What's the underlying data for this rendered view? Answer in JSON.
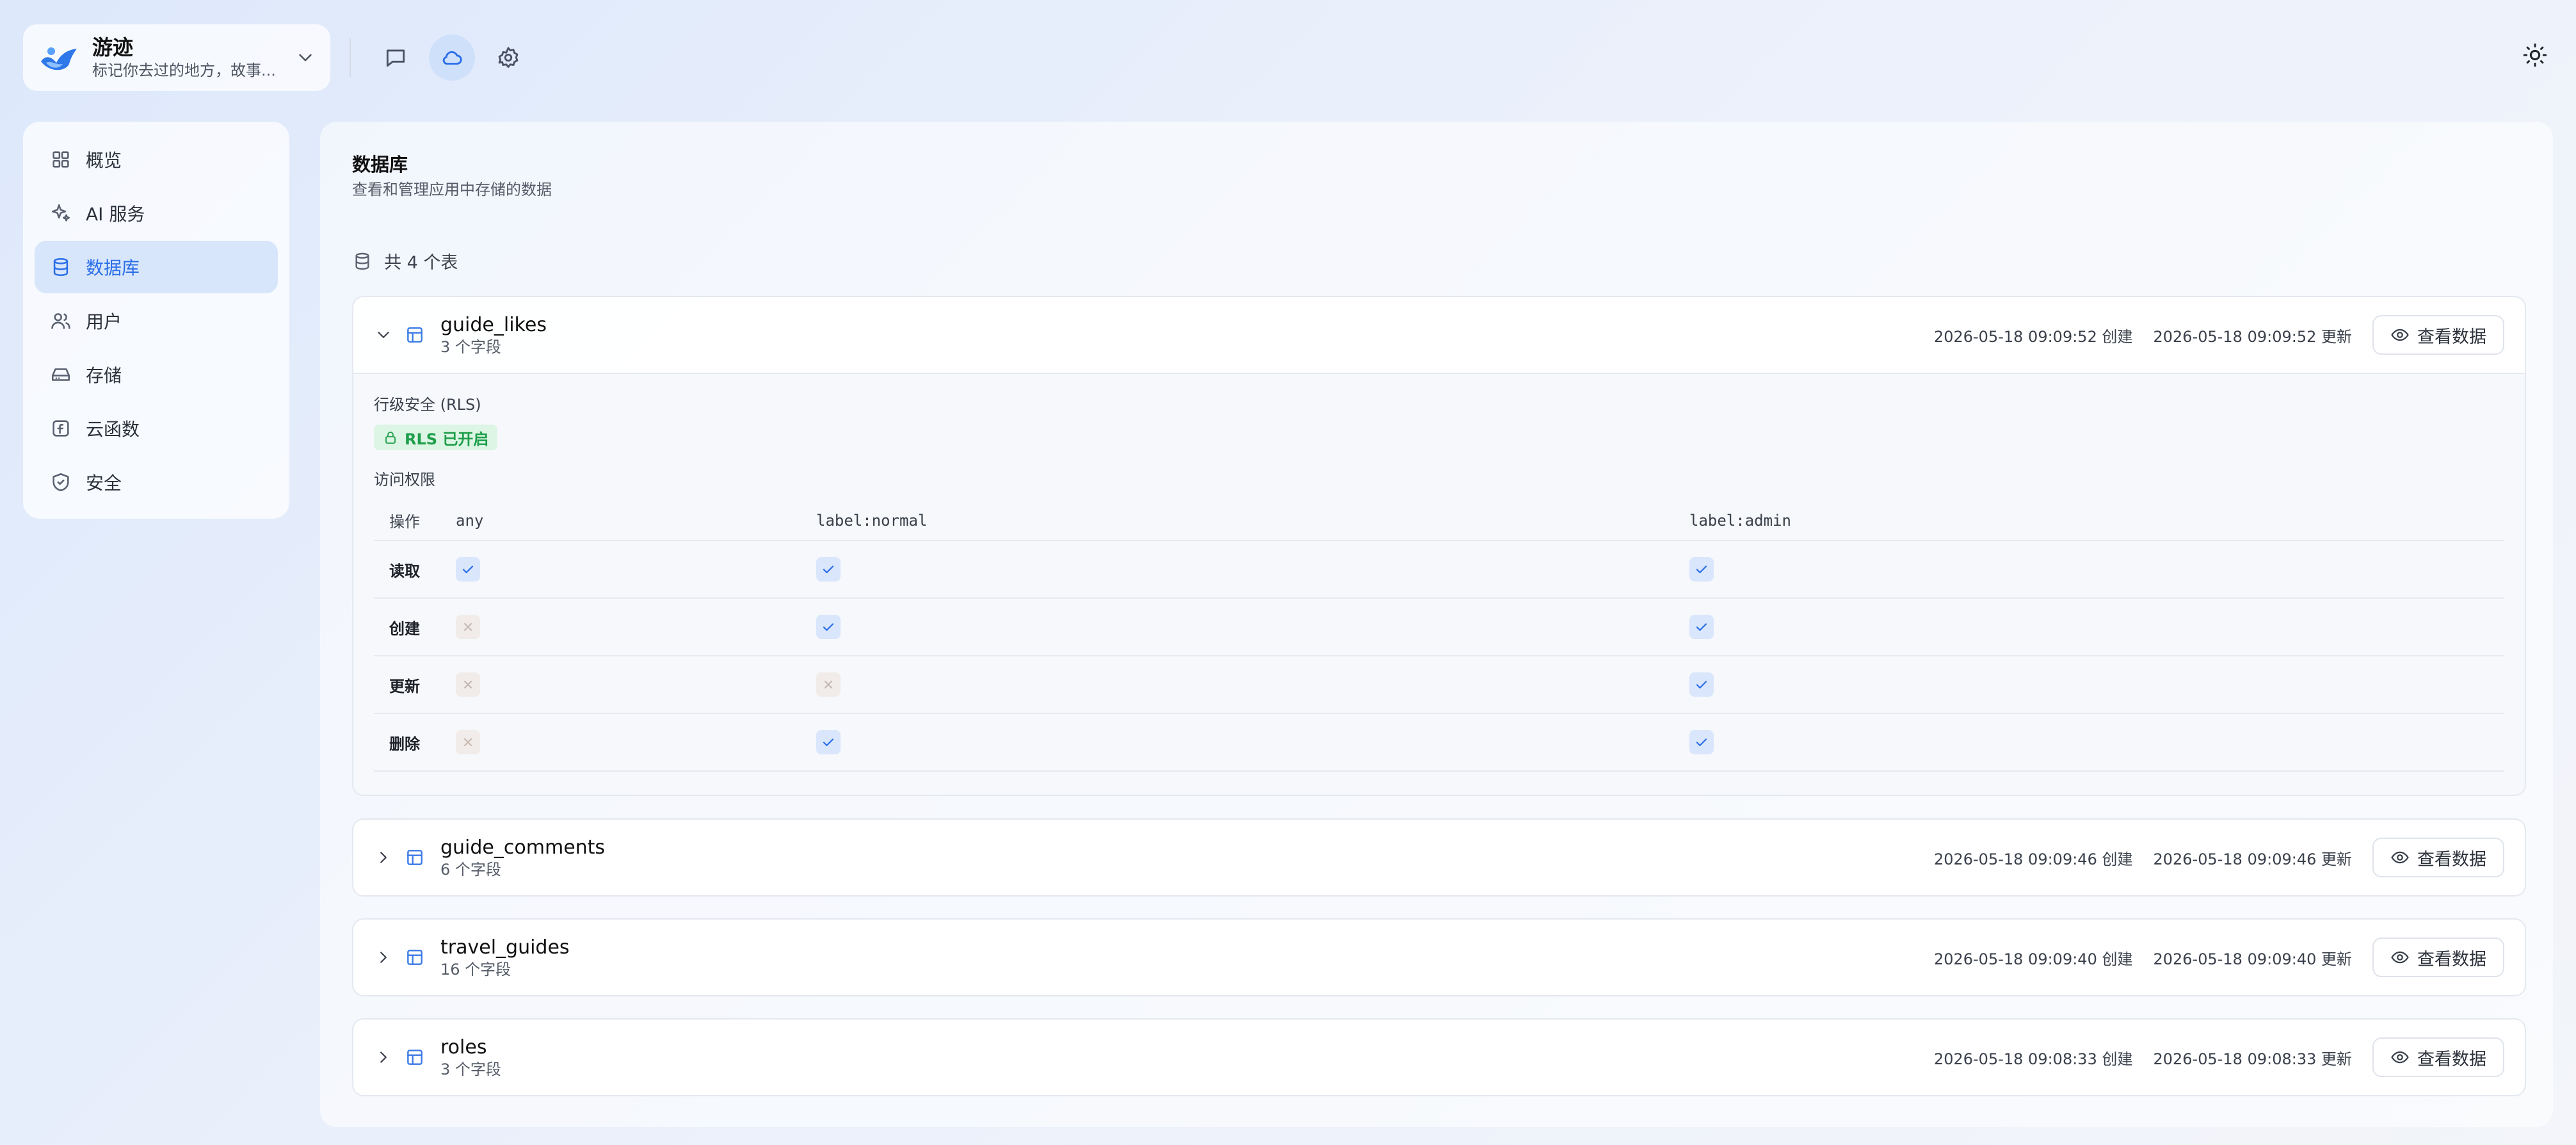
{
  "app": {
    "name": "游迹",
    "description": "标记你去过的地方，故事..."
  },
  "sidebar": {
    "items": [
      {
        "label": "概览",
        "icon": "grid-icon"
      },
      {
        "label": "AI 服务",
        "icon": "sparkles-icon"
      },
      {
        "label": "数据库",
        "icon": "database-icon",
        "active": true
      },
      {
        "label": "用户",
        "icon": "users-icon"
      },
      {
        "label": "存储",
        "icon": "hard-drive-icon"
      },
      {
        "label": "云函数",
        "icon": "function-icon"
      },
      {
        "label": "安全",
        "icon": "shield-icon"
      }
    ]
  },
  "page": {
    "title": "数据库",
    "subtitle": "查看和管理应用中存储的数据",
    "table_count": "共 4 个表"
  },
  "tables": [
    {
      "name": "guide_likes",
      "fields": "3 个字段",
      "expanded": true,
      "created": "2026-05-18 09:09:52 创建",
      "updated": "2026-05-18 09:09:52 更新",
      "view_label": "查看数据"
    },
    {
      "name": "guide_comments",
      "fields": "6 个字段",
      "expanded": false,
      "created": "2026-05-18 09:09:46 创建",
      "updated": "2026-05-18 09:09:46 更新",
      "view_label": "查看数据"
    },
    {
      "name": "travel_guides",
      "fields": "16 个字段",
      "expanded": false,
      "created": "2026-05-18 09:09:40 创建",
      "updated": "2026-05-18 09:09:40 更新",
      "view_label": "查看数据"
    },
    {
      "name": "roles",
      "fields": "3 个字段",
      "expanded": false,
      "created": "2026-05-18 09:08:33 创建",
      "updated": "2026-05-18 09:08:33 更新",
      "view_label": "查看数据"
    }
  ],
  "rls": {
    "section_label": "行级安全 (RLS)",
    "badge": "RLS 已开启",
    "permissions_label": "访问权限",
    "columns": [
      "操作",
      "any",
      "label:normal",
      "label:admin"
    ],
    "rows": [
      {
        "action": "读取",
        "values": [
          true,
          true,
          true
        ]
      },
      {
        "action": "创建",
        "values": [
          false,
          true,
          true
        ]
      },
      {
        "action": "更新",
        "values": [
          false,
          false,
          true
        ]
      },
      {
        "action": "删除",
        "values": [
          false,
          true,
          true
        ]
      }
    ]
  },
  "colors": {
    "accent": "#2a6ee8",
    "active_bg": "#d8e6fb",
    "rls_green": "#1e9e4a"
  }
}
